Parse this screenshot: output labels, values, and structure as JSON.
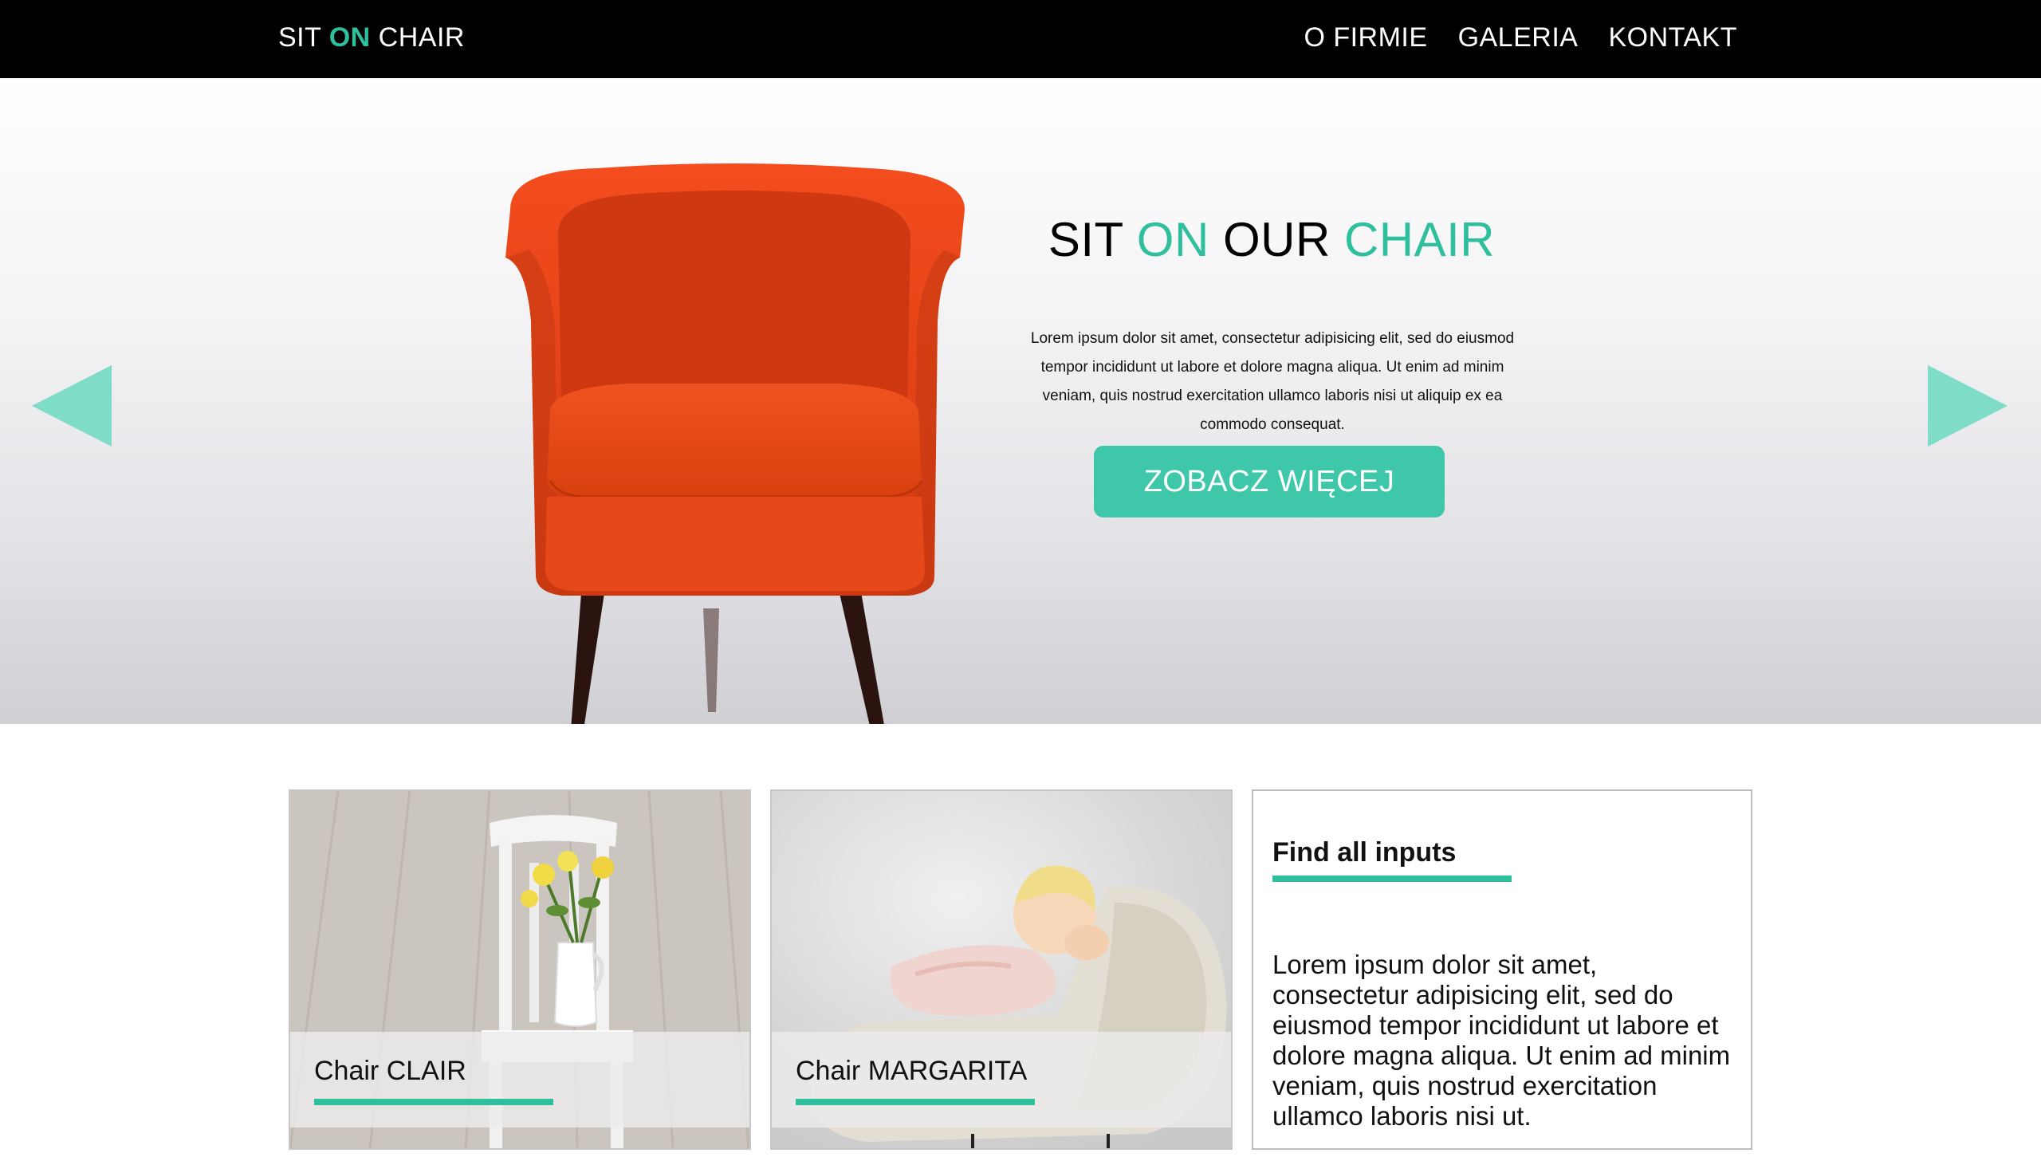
{
  "header": {
    "logo": {
      "part1": "SIT ",
      "part2": "ON",
      "part3": " CHAIR"
    },
    "nav": [
      "O FIRMIE",
      "GALERIA",
      "KONTAKT"
    ]
  },
  "hero": {
    "title": {
      "part1": "SIT ",
      "part2": "ON",
      "part3": " OUR ",
      "part4": "CHAIR"
    },
    "text": "Lorem ipsum dolor sit amet, consectetur adipisicing elit, sed do eiusmod tempor incididunt ut labore et dolore magna aliqua. Ut enim ad minim veniam, quis nostrud exercitation ullamco laboris nisi ut aliquip ex ea commodo consequat.",
    "button": "ZOBACZ WIĘCEJ"
  },
  "cards": [
    {
      "label": "Chair CLAIR"
    },
    {
      "label": "Chair MARGARITA"
    }
  ],
  "info": {
    "title": "Find all inputs",
    "text": "Lorem ipsum dolor sit amet, consectetur adipisicing elit, sed do eiusmod tempor incididunt ut labore et dolore magna aliqua. Ut enim ad minim veniam, quis nostrud exercitation ullamco laboris nisi ut."
  },
  "colors": {
    "accent": "#2fbf9c",
    "button": "#3ec8a9",
    "arrow": "#7fdcc6",
    "chair": "#e8461c"
  },
  "icons": {
    "prev": "triangle-left-icon",
    "next": "triangle-right-icon"
  }
}
